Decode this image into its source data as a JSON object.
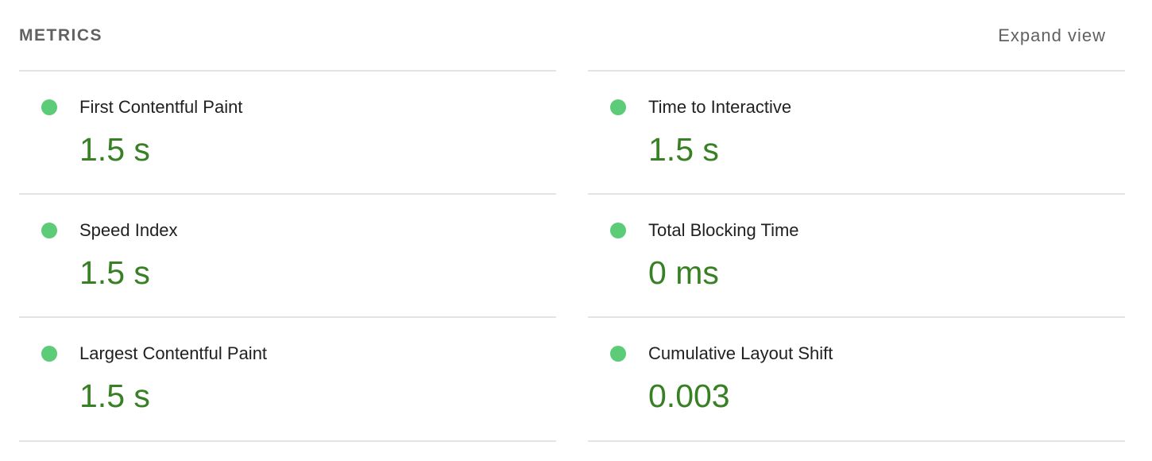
{
  "header": {
    "title": "METRICS",
    "expand_label": "Expand view"
  },
  "colors": {
    "pass_dot": "#5ccc78",
    "pass_value": "#378024",
    "label_text": "#212121",
    "muted_text": "#616161",
    "divider": "#e4e4e4"
  },
  "metrics": {
    "left": [
      {
        "label": "First Contentful Paint",
        "value": "1.5 s",
        "status": "pass"
      },
      {
        "label": "Speed Index",
        "value": "1.5 s",
        "status": "pass"
      },
      {
        "label": "Largest Contentful Paint",
        "value": "1.5 s",
        "status": "pass"
      }
    ],
    "right": [
      {
        "label": "Time to Interactive",
        "value": "1.5 s",
        "status": "pass"
      },
      {
        "label": "Total Blocking Time",
        "value": "0 ms",
        "status": "pass"
      },
      {
        "label": "Cumulative Layout Shift",
        "value": "0.003",
        "status": "pass"
      }
    ]
  }
}
